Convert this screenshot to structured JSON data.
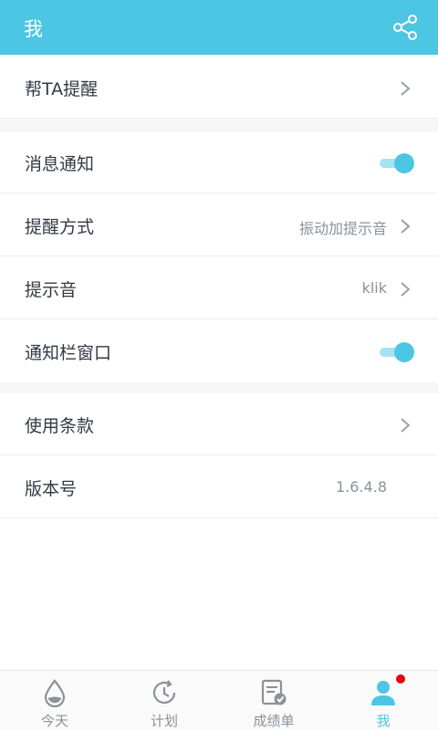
{
  "header": {
    "title": "我",
    "share_icon": "share-icon"
  },
  "section1": [
    {
      "label": "帮TA提醒",
      "value": ""
    }
  ],
  "section2": [
    {
      "label": "消息通知",
      "toggle": true
    },
    {
      "label": "提醒方式",
      "value": "振动加提示音"
    },
    {
      "label": "提示音",
      "value": "klik"
    },
    {
      "label": "通知栏窗口",
      "toggle": true
    }
  ],
  "section3": [
    {
      "label": "使用条款",
      "value": ""
    },
    {
      "label": "版本号",
      "value": "1.6.4.8"
    }
  ],
  "tabbar": [
    {
      "label": "今天",
      "icon": "drop-icon"
    },
    {
      "label": "计划",
      "icon": "clock-icon"
    },
    {
      "label": "成绩单",
      "icon": "report-icon"
    },
    {
      "label": "我",
      "icon": "user-icon",
      "active": true,
      "badge": true
    }
  ],
  "colors": {
    "accent": "#4cc6e2",
    "badge": "#e60012",
    "text": "#333a44",
    "muted": "#8b929a"
  }
}
